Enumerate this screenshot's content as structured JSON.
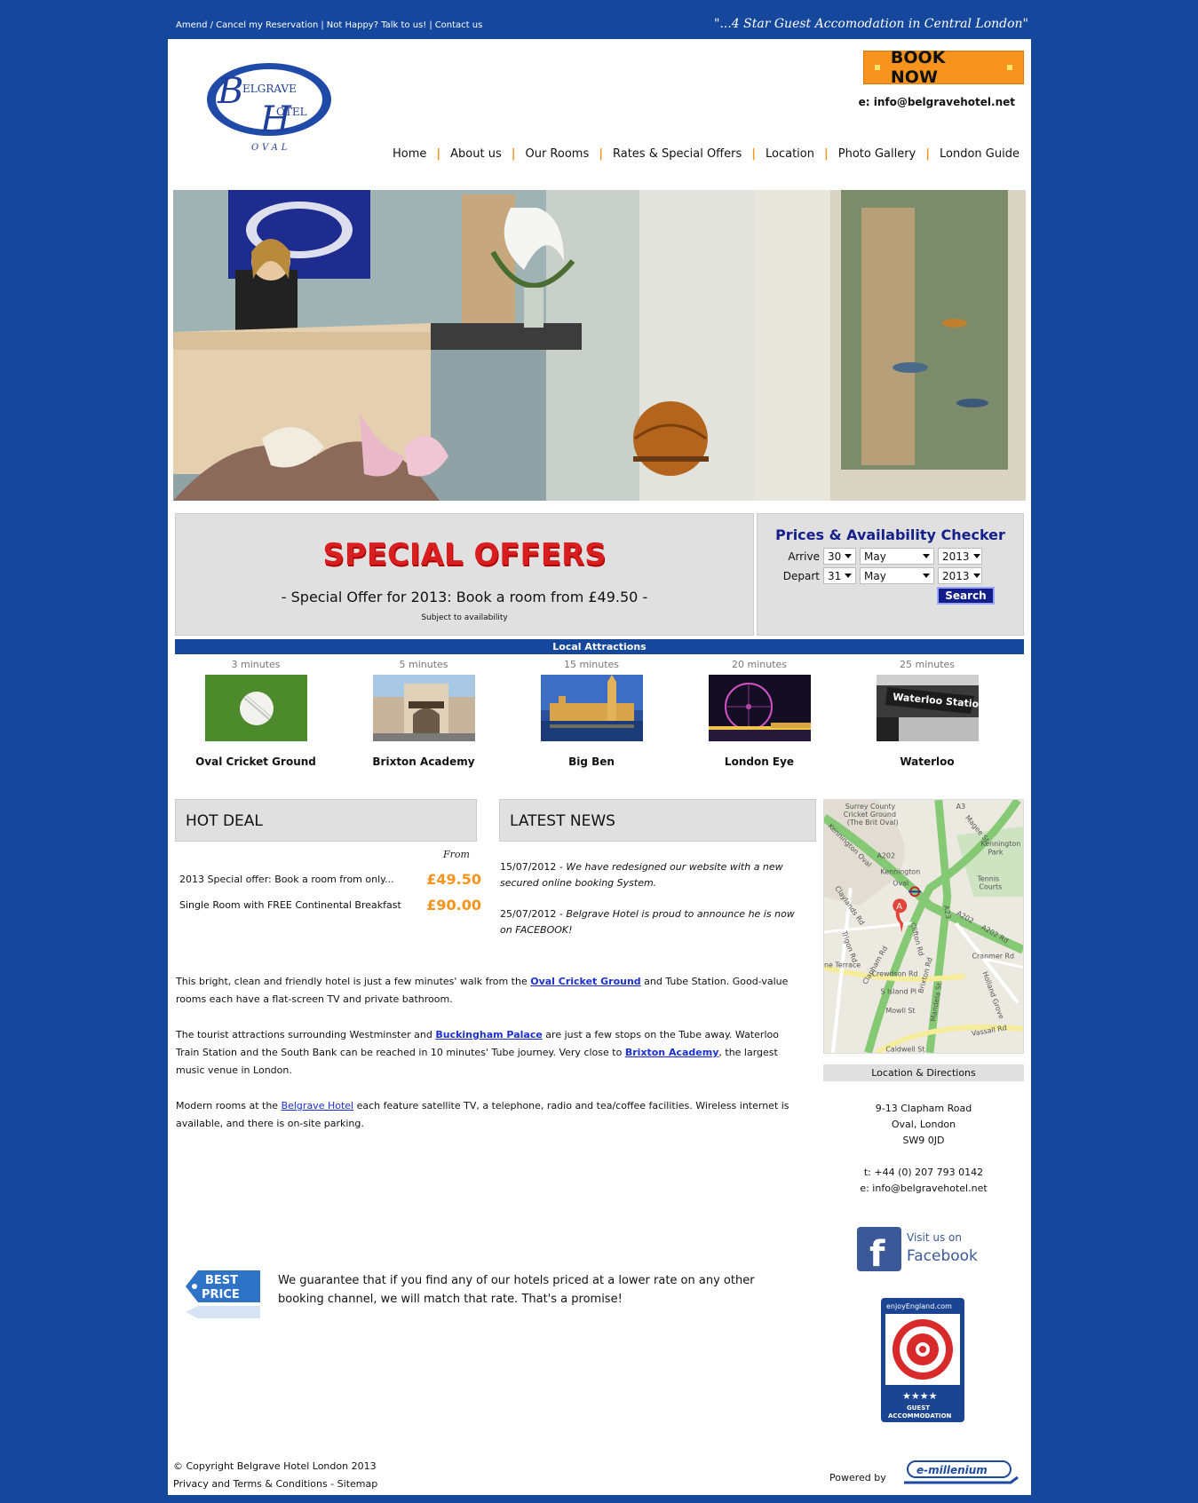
{
  "top": {
    "links": [
      "Amend / Cancel my Reservation",
      "Not Happy? Talk to us!",
      "Contact us"
    ],
    "tagline": "\"...4 Star Guest Accomodation in Central London\""
  },
  "header": {
    "book_now": "BOOK NOW",
    "email": "e: info@belgravehotel.net",
    "logo_text": {
      "line1": "ELGRAVE",
      "line2": "OTEL",
      "initial1": "B",
      "initial2": "H",
      "sub": "OVAL"
    }
  },
  "nav": [
    "Home",
    "About us",
    "Our Rooms",
    "Rates & Special Offers",
    "Location",
    "Photo Gallery",
    "London Guide"
  ],
  "offers": {
    "title": "SPECIAL OFFERS",
    "subtitle": "- Special Offer for 2013: Book a room from £49.50 -",
    "note": "Subject to availability"
  },
  "checker": {
    "title": "Prices & Availability Checker",
    "arrive_label": "Arrive",
    "depart_label": "Depart",
    "arrive": {
      "day": "30",
      "month": "May",
      "year": "2013"
    },
    "depart": {
      "day": "31",
      "month": "May",
      "year": "2013"
    },
    "search": "Search"
  },
  "attractions": {
    "heading": "Local Attractions",
    "items": [
      {
        "minutes": "3 minutes",
        "name": "Oval Cricket Ground"
      },
      {
        "minutes": "5 minutes",
        "name": "Brixton Academy"
      },
      {
        "minutes": "15 minutes",
        "name": "Big Ben"
      },
      {
        "minutes": "20 minutes",
        "name": "London Eye"
      },
      {
        "minutes": "25 minutes",
        "name": "Waterloo"
      }
    ],
    "waterloo_sign": "Waterloo Station"
  },
  "hot_deal": {
    "heading": "HOT DEAL",
    "from": "From",
    "rows": [
      {
        "label": "2013 Special offer: Book a room from only...",
        "price": "£49.50"
      },
      {
        "label": "Single Room with FREE Continental Breakfast",
        "price": "£90.00"
      }
    ]
  },
  "news": {
    "heading": "LATEST NEWS",
    "items": [
      {
        "date": "15/07/2012",
        "text": " - We have redesigned our website with a new secured online booking System."
      },
      {
        "date": "25/07/2012",
        "text": " - Belgrave Hotel is proud to announce he is now on FACEBOOK!"
      }
    ]
  },
  "body": {
    "p1a": "This bright, clean and friendly hotel is just a few minutes' walk from the ",
    "p1link": "Oval Cricket Ground",
    "p1b": " and Tube Station. Good-value rooms each have a flat-screen TV and private bathroom.",
    "p2a": "The tourist attractions surrounding Westminster and ",
    "p2link1": "Buckingham Palace",
    "p2b": " are just a few stops on the Tube away. Waterloo Train Station and the South Bank can be reached in 10 minutes' Tube journey. Very close to ",
    "p2link2": "Brixton Academy",
    "p2c": ", the largest music venue in London.",
    "p3a": "Modern rooms at the ",
    "p3link": "Belgrave Hotel",
    "p3b": " each feature satellite TV, a telephone, radio and tea/coffee facilities. Wireless internet is available, and there is on-site parking."
  },
  "best_price": {
    "badge1": "BEST",
    "badge2": "PRICE",
    "text": "We guarantee that if you find any of our hotels priced at a lower rate on any other booking channel, we will match that rate. That's a promise!"
  },
  "map": {
    "labels": [
      "Surrey County",
      "Cricket Ground",
      "(The Brit Oval)",
      "Kennington Oval",
      "A202",
      "Magee St",
      "A3",
      "Kennington",
      "Park",
      "Kennington",
      "Oval",
      "Tennis",
      "Courts",
      "Claylands Rd",
      "Trigon Rd",
      "Clapham Rd",
      "Clifton Rd",
      "A23",
      "A202",
      "A202 Rd",
      "Cranmer Rd",
      "Crewdson Rd",
      "ne Terrace",
      "S Island Pl",
      "Brixton Rd",
      "Mandela St",
      "Holland Grove",
      "Mowll St",
      "Vassall Rd",
      "Caldwell St",
      "A"
    ]
  },
  "location": {
    "heading": "Location & Directions",
    "address": [
      "9-13 Clapham Road",
      "Oval, London",
      "SW9 0JD"
    ],
    "phone": "t: +44 (0) 207 793 0142",
    "email": "e: info@belgravehotel.net"
  },
  "facebook": {
    "line1": "Visit us on",
    "line2": "Facebook"
  },
  "enjoy_england": {
    "site": "enjoyEngland.com",
    "stars": "★★★★",
    "line1": "GUEST",
    "line2": "ACCOMMODATION"
  },
  "footer": {
    "copyright": "© Copyright Belgrave Hotel London  2013",
    "privacy": "Privacy and Terms & Conditions",
    "sitemap": "Sitemap",
    "powered": "Powered by",
    "emillenium": "e-millenium"
  },
  "colors": {
    "brand_blue": "#15479c",
    "orange": "#f7941d",
    "offer_red": "#d81e1e",
    "panel_grey": "#e0e0e0"
  }
}
